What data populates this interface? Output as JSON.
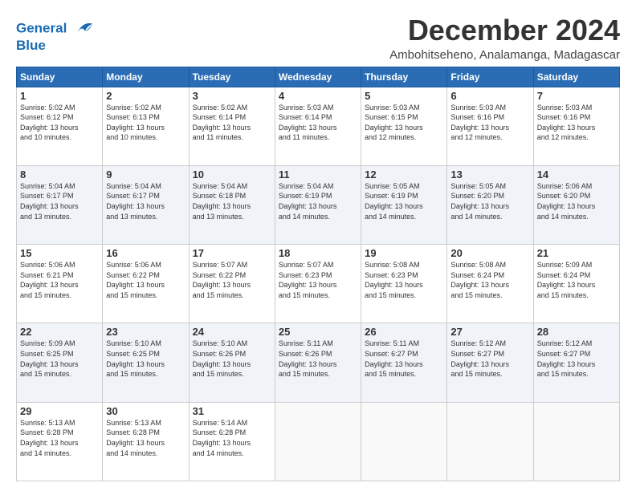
{
  "logo": {
    "line1": "General",
    "line2": "Blue"
  },
  "title": "December 2024",
  "subtitle": "Ambohitseheno, Analamanga, Madagascar",
  "header": {
    "days": [
      "Sunday",
      "Monday",
      "Tuesday",
      "Wednesday",
      "Thursday",
      "Friday",
      "Saturday"
    ]
  },
  "weeks": [
    [
      {
        "day": "1",
        "info": "Sunrise: 5:02 AM\nSunset: 6:12 PM\nDaylight: 13 hours\nand 10 minutes."
      },
      {
        "day": "2",
        "info": "Sunrise: 5:02 AM\nSunset: 6:13 PM\nDaylight: 13 hours\nand 10 minutes."
      },
      {
        "day": "3",
        "info": "Sunrise: 5:02 AM\nSunset: 6:14 PM\nDaylight: 13 hours\nand 11 minutes."
      },
      {
        "day": "4",
        "info": "Sunrise: 5:03 AM\nSunset: 6:14 PM\nDaylight: 13 hours\nand 11 minutes."
      },
      {
        "day": "5",
        "info": "Sunrise: 5:03 AM\nSunset: 6:15 PM\nDaylight: 13 hours\nand 12 minutes."
      },
      {
        "day": "6",
        "info": "Sunrise: 5:03 AM\nSunset: 6:16 PM\nDaylight: 13 hours\nand 12 minutes."
      },
      {
        "day": "7",
        "info": "Sunrise: 5:03 AM\nSunset: 6:16 PM\nDaylight: 13 hours\nand 12 minutes."
      }
    ],
    [
      {
        "day": "8",
        "info": "Sunrise: 5:04 AM\nSunset: 6:17 PM\nDaylight: 13 hours\nand 13 minutes."
      },
      {
        "day": "9",
        "info": "Sunrise: 5:04 AM\nSunset: 6:17 PM\nDaylight: 13 hours\nand 13 minutes."
      },
      {
        "day": "10",
        "info": "Sunrise: 5:04 AM\nSunset: 6:18 PM\nDaylight: 13 hours\nand 13 minutes."
      },
      {
        "day": "11",
        "info": "Sunrise: 5:04 AM\nSunset: 6:19 PM\nDaylight: 13 hours\nand 14 minutes."
      },
      {
        "day": "12",
        "info": "Sunrise: 5:05 AM\nSunset: 6:19 PM\nDaylight: 13 hours\nand 14 minutes."
      },
      {
        "day": "13",
        "info": "Sunrise: 5:05 AM\nSunset: 6:20 PM\nDaylight: 13 hours\nand 14 minutes."
      },
      {
        "day": "14",
        "info": "Sunrise: 5:06 AM\nSunset: 6:20 PM\nDaylight: 13 hours\nand 14 minutes."
      }
    ],
    [
      {
        "day": "15",
        "info": "Sunrise: 5:06 AM\nSunset: 6:21 PM\nDaylight: 13 hours\nand 15 minutes."
      },
      {
        "day": "16",
        "info": "Sunrise: 5:06 AM\nSunset: 6:22 PM\nDaylight: 13 hours\nand 15 minutes."
      },
      {
        "day": "17",
        "info": "Sunrise: 5:07 AM\nSunset: 6:22 PM\nDaylight: 13 hours\nand 15 minutes."
      },
      {
        "day": "18",
        "info": "Sunrise: 5:07 AM\nSunset: 6:23 PM\nDaylight: 13 hours\nand 15 minutes."
      },
      {
        "day": "19",
        "info": "Sunrise: 5:08 AM\nSunset: 6:23 PM\nDaylight: 13 hours\nand 15 minutes."
      },
      {
        "day": "20",
        "info": "Sunrise: 5:08 AM\nSunset: 6:24 PM\nDaylight: 13 hours\nand 15 minutes."
      },
      {
        "day": "21",
        "info": "Sunrise: 5:09 AM\nSunset: 6:24 PM\nDaylight: 13 hours\nand 15 minutes."
      }
    ],
    [
      {
        "day": "22",
        "info": "Sunrise: 5:09 AM\nSunset: 6:25 PM\nDaylight: 13 hours\nand 15 minutes."
      },
      {
        "day": "23",
        "info": "Sunrise: 5:10 AM\nSunset: 6:25 PM\nDaylight: 13 hours\nand 15 minutes."
      },
      {
        "day": "24",
        "info": "Sunrise: 5:10 AM\nSunset: 6:26 PM\nDaylight: 13 hours\nand 15 minutes."
      },
      {
        "day": "25",
        "info": "Sunrise: 5:11 AM\nSunset: 6:26 PM\nDaylight: 13 hours\nand 15 minutes."
      },
      {
        "day": "26",
        "info": "Sunrise: 5:11 AM\nSunset: 6:27 PM\nDaylight: 13 hours\nand 15 minutes."
      },
      {
        "day": "27",
        "info": "Sunrise: 5:12 AM\nSunset: 6:27 PM\nDaylight: 13 hours\nand 15 minutes."
      },
      {
        "day": "28",
        "info": "Sunrise: 5:12 AM\nSunset: 6:27 PM\nDaylight: 13 hours\nand 15 minutes."
      }
    ],
    [
      {
        "day": "29",
        "info": "Sunrise: 5:13 AM\nSunset: 6:28 PM\nDaylight: 13 hours\nand 14 minutes."
      },
      {
        "day": "30",
        "info": "Sunrise: 5:13 AM\nSunset: 6:28 PM\nDaylight: 13 hours\nand 14 minutes."
      },
      {
        "day": "31",
        "info": "Sunrise: 5:14 AM\nSunset: 6:28 PM\nDaylight: 13 hours\nand 14 minutes."
      },
      {
        "day": "",
        "info": ""
      },
      {
        "day": "",
        "info": ""
      },
      {
        "day": "",
        "info": ""
      },
      {
        "day": "",
        "info": ""
      }
    ]
  ]
}
